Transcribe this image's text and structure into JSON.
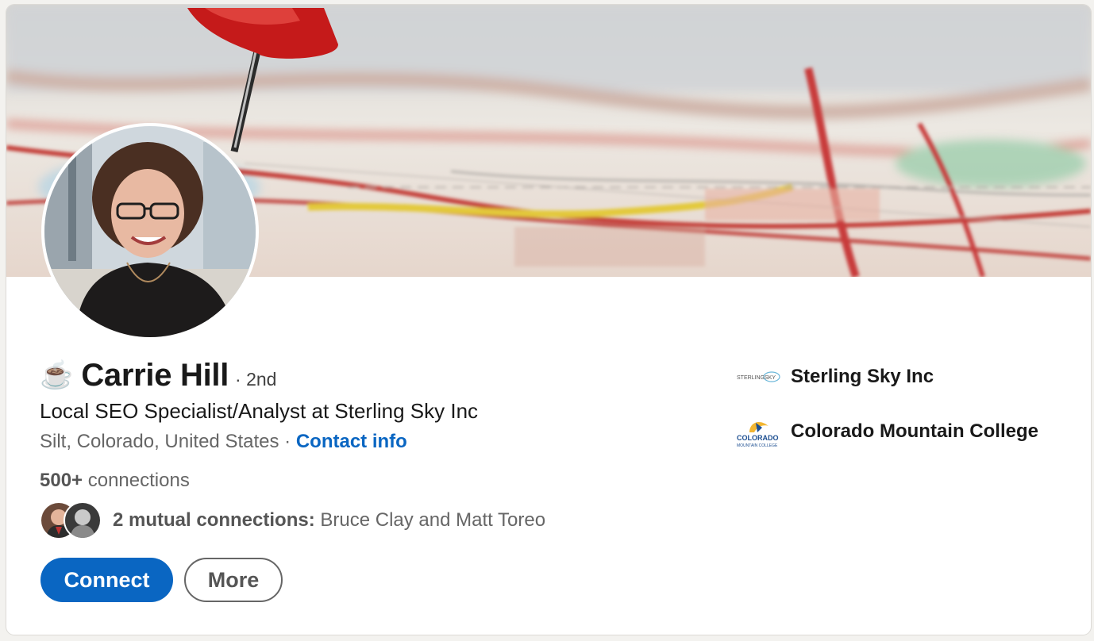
{
  "profile": {
    "emoji": "☕",
    "name": "Carrie Hill",
    "degree": "· 2nd",
    "headline": "Local SEO Specialist/Analyst at Sterling Sky Inc",
    "location": "Silt, Colorado, United States",
    "separator": " · ",
    "contact_label": "Contact info",
    "connections_count": "500+",
    "connections_label": " connections",
    "mutual_count_label": "2 mutual connections:",
    "mutual_names": " Bruce Clay and Matt Toreo"
  },
  "actions": {
    "connect_label": "Connect",
    "more_label": "More"
  },
  "organizations": [
    {
      "name": "Sterling Sky Inc",
      "logo_text": "STERLINGSKY",
      "logo_icon": "sterling-sky-logo"
    },
    {
      "name": "Colorado Mountain College",
      "logo_text_1": "COLORADO",
      "logo_text_2": "MOUNTAIN COLLEGE",
      "logo_icon": "colorado-mountain-college-logo"
    }
  ],
  "colors": {
    "accent": "#0a66c2",
    "text_primary": "#191919",
    "text_secondary": "#666666"
  }
}
